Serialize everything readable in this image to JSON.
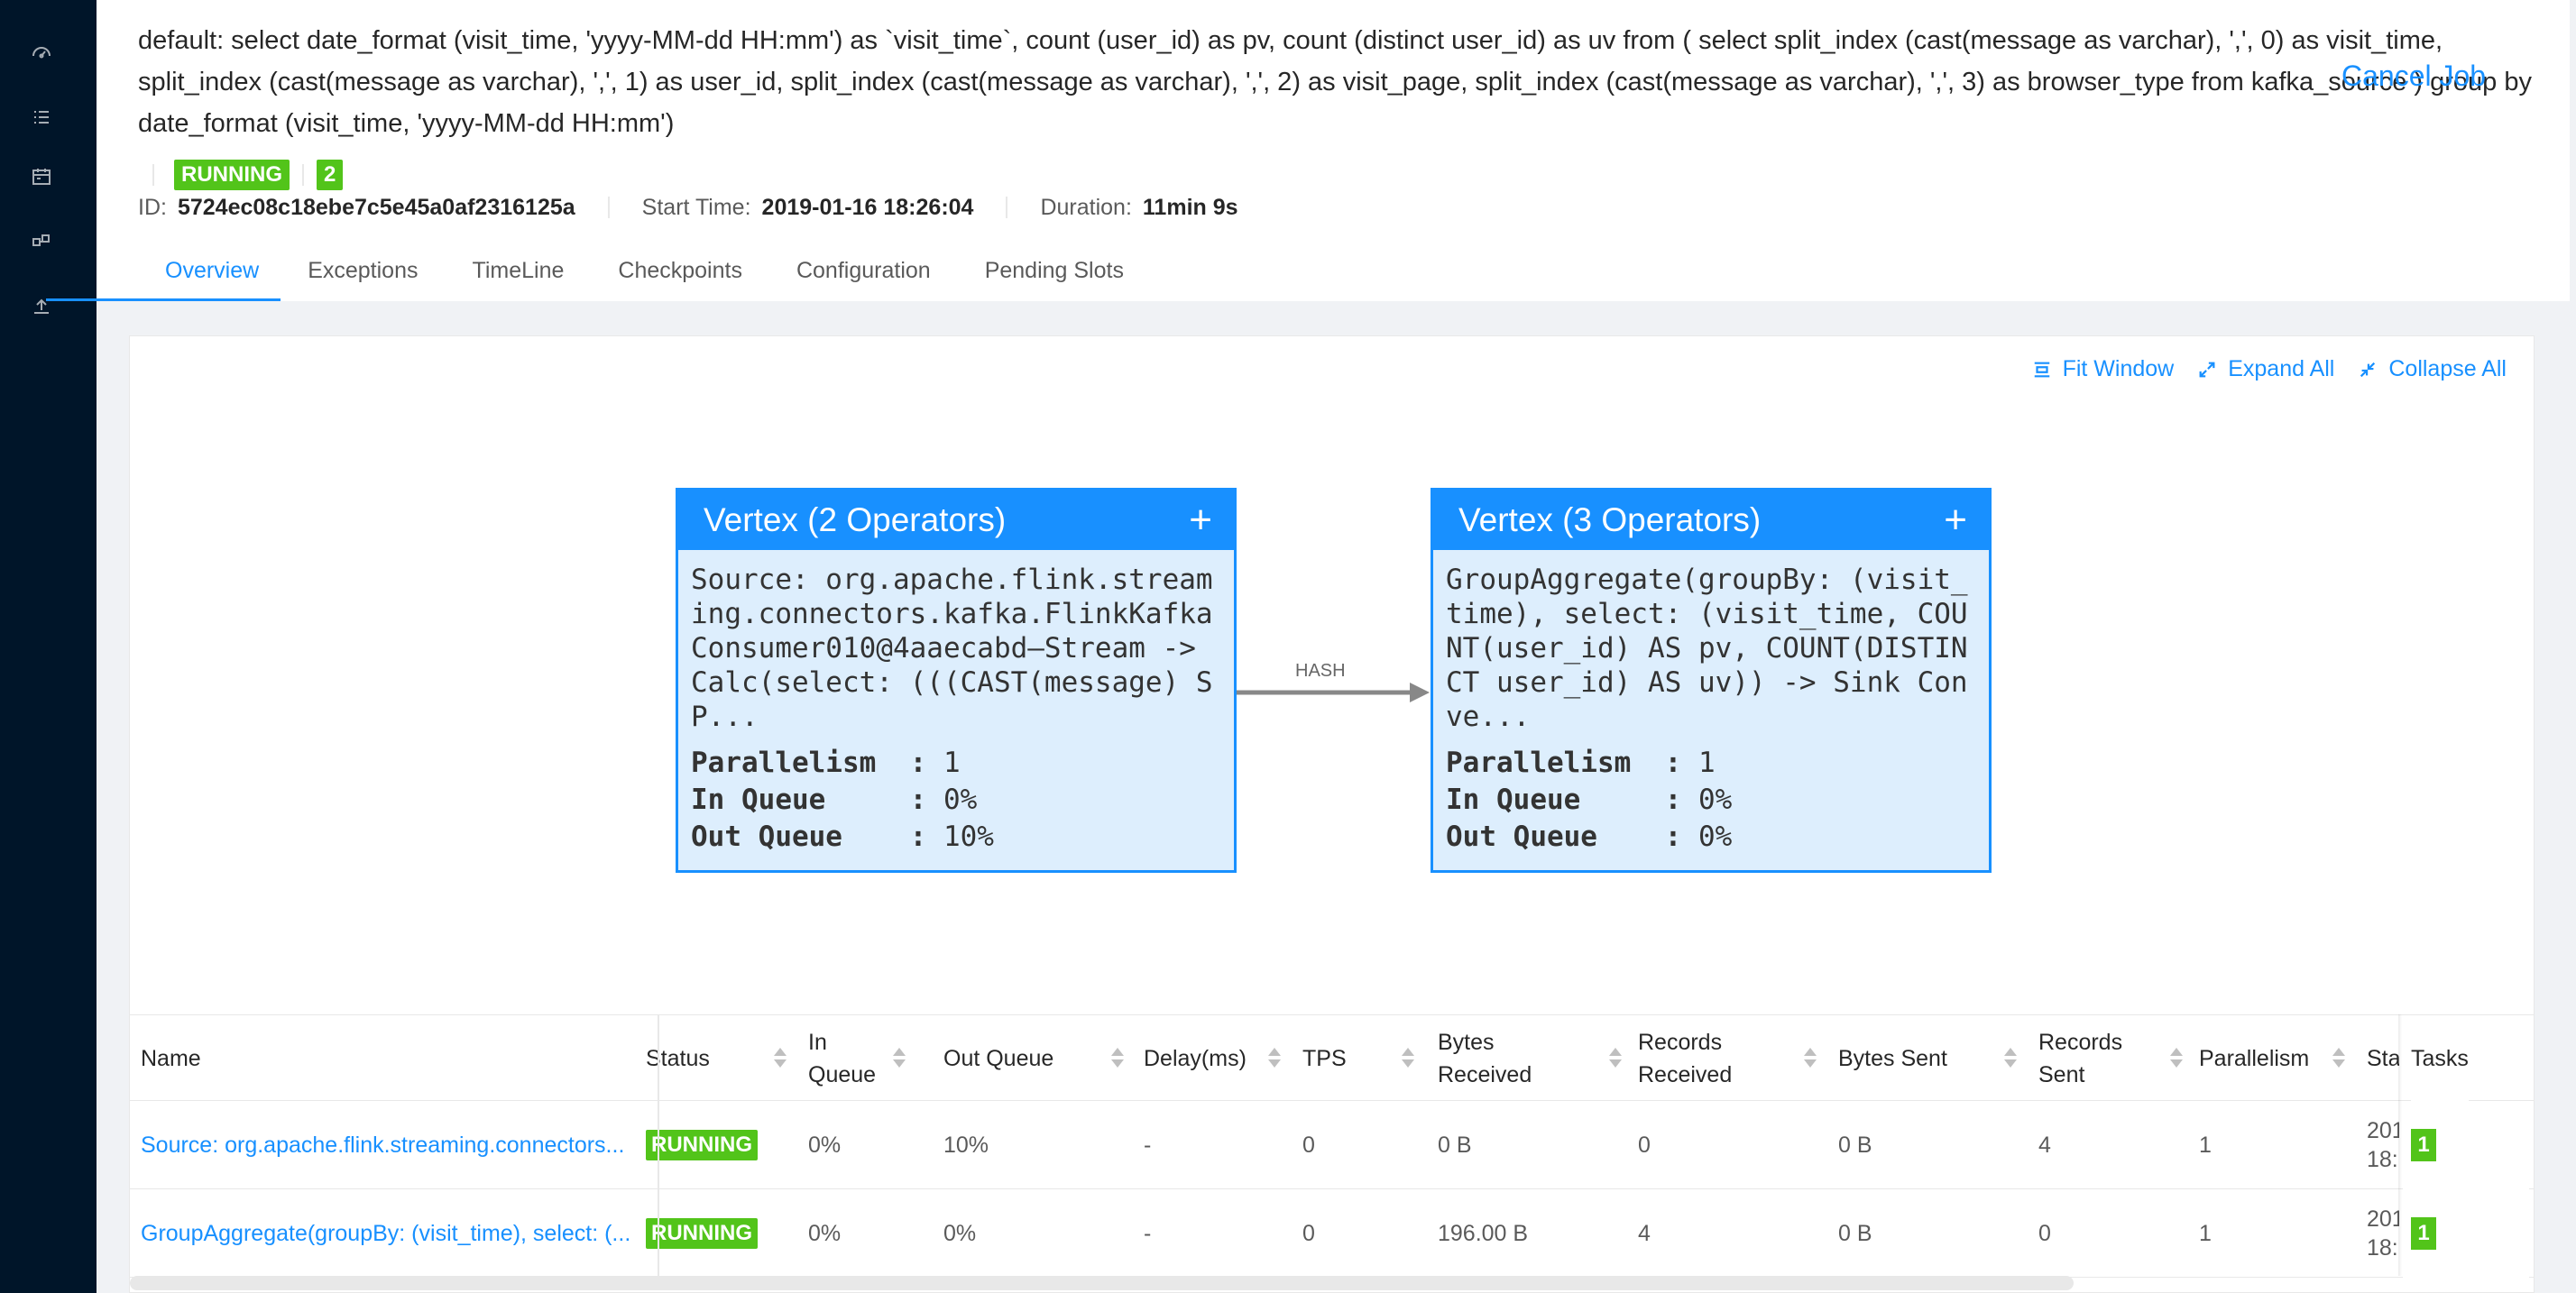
{
  "sidebar": {
    "icons": [
      "dashboard-icon",
      "list-icon",
      "calendar-icon",
      "cluster-icon",
      "upload-icon"
    ]
  },
  "job": {
    "title": "default: select date_format (visit_time, 'yyyy-MM-dd HH:mm') as `visit_time`, count (user_id) as pv, count (distinct user_id) as uv from ( select split_index (cast(message as varchar), ',', 0) as visit_time, split_index (cast(message as varchar), ',', 1) as user_id, split_index (cast(message as varchar), ',', 2) as visit_page, split_index (cast(message as varchar), ',', 3) as browser_type from kafka_source ) group by date_format (visit_time, 'yyyy-MM-dd HH:mm')",
    "cancel_label": "Cancel Job",
    "status": "RUNNING",
    "task_count": "2",
    "id_label": "ID:",
    "id_value": "5724ec08c18ebe7c5e45a0af2316125a",
    "start_label": "Start Time:",
    "start_value": "2019-01-16 18:26:04",
    "duration_label": "Duration:",
    "duration_value": "11min 9s"
  },
  "tabs": [
    {
      "label": "Overview",
      "active": true
    },
    {
      "label": "Exceptions"
    },
    {
      "label": "TimeLine"
    },
    {
      "label": "Checkpoints"
    },
    {
      "label": "Configuration"
    },
    {
      "label": "Pending Slots"
    }
  ],
  "graph": {
    "actions": {
      "fit": "Fit Window",
      "expand": "Expand All",
      "collapse": "Collapse All"
    },
    "edge_label": "HASH",
    "nodes": [
      {
        "title": "Vertex (2 Operators)",
        "plus": "+",
        "description": "Source: org.apache.flink.streaming.connectors.kafka.FlinkKafkaConsumer010@4aaecabd–Stream -> Calc(select: (((CAST(message) SP...",
        "parallelism_label": "Parallelism  :",
        "parallelism": "1",
        "in_queue_label": "In Queue     :",
        "in_queue": "0%",
        "out_queue_label": "Out Queue    :",
        "out_queue": "10%"
      },
      {
        "title": "Vertex (3 Operators)",
        "plus": "+",
        "description": "GroupAggregate(groupBy: (visit_time), select: (visit_time, COUNT(user_id) AS pv, COUNT(DISTINCT user_id) AS uv)) -> Sink Conve...",
        "parallelism_label": "Parallelism  :",
        "parallelism": "1",
        "in_queue_label": "In Queue     :",
        "in_queue": "0%",
        "out_queue_label": "Out Queue    :",
        "out_queue": "0%"
      }
    ]
  },
  "table": {
    "resize_handle": "...",
    "headers": {
      "name": "Name",
      "status": "Status",
      "in_queue_1": "In",
      "in_queue_2": "Queue",
      "out_queue": "Out Queue",
      "delay": "Delay(ms)",
      "tps": "TPS",
      "bytes_received_1": "Bytes",
      "bytes_received_2": "Received",
      "records_received_1": "Records",
      "records_received_2": "Received",
      "bytes_sent": "Bytes Sent",
      "records_sent_1": "Records",
      "records_sent_2": "Sent",
      "parallelism": "Parallelism",
      "start": "Sta",
      "tasks": "Tasks"
    },
    "rows": [
      {
        "name": "Source: org.apache.flink.streaming.connectors...",
        "status": "RUNNING",
        "in_queue": "0%",
        "out_queue": "10%",
        "delay": "-",
        "tps": "0",
        "bytes_received": "0 B",
        "records_received": "0",
        "bytes_sent": "0 B",
        "records_sent": "4",
        "parallelism": "1",
        "start_1": "201",
        "start_2": "18:",
        "tasks": "1"
      },
      {
        "name": "GroupAggregate(groupBy: (visit_time), select: (...",
        "status": "RUNNING",
        "in_queue": "0%",
        "out_queue": "0%",
        "delay": "-",
        "tps": "0",
        "bytes_received": "196.00 B",
        "records_received": "4",
        "bytes_sent": "0 B",
        "records_sent": "0",
        "parallelism": "1",
        "start_1": "201",
        "start_2": "18:",
        "tasks": "1"
      }
    ]
  }
}
